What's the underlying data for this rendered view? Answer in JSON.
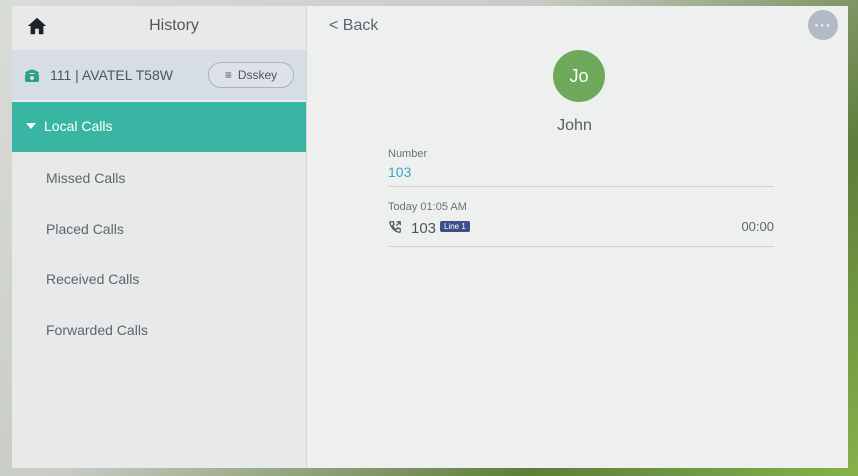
{
  "sidebar": {
    "title": "History",
    "account": {
      "label": "111 | AVATEL T58W",
      "dsskey_label": "Dsskey"
    },
    "selected_group": "Local Calls",
    "items": [
      {
        "label": "Missed Calls"
      },
      {
        "label": "Placed Calls"
      },
      {
        "label": "Received Calls"
      },
      {
        "label": "Forwarded Calls"
      }
    ]
  },
  "main": {
    "back_label": "< Back",
    "more_label": "···",
    "avatar_initials": "Jo",
    "contact_name": "John",
    "number_label": "Number",
    "number_value": "103",
    "call": {
      "time": "Today 01:05 AM",
      "number": "103",
      "line_badge": "Line 1",
      "duration": "00:00"
    }
  },
  "colors": {
    "accent": "#39b6a3",
    "avatar": "#6ea85a",
    "link": "#3aa7c8",
    "badge": "#3c4f8a"
  },
  "icons": {
    "home": "home-icon",
    "phone": "phone-icon",
    "dsskey": "menu-icon",
    "expand": "triangle-down-icon",
    "call_direction": "outgoing-call-icon",
    "more": "more-icon"
  }
}
